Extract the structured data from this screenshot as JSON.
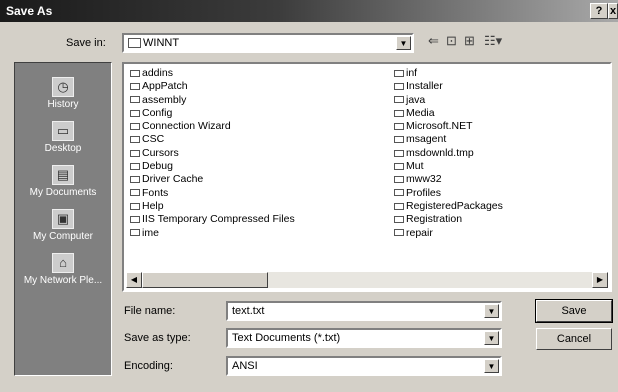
{
  "window": {
    "title": "Save As",
    "help_label": "?",
    "close_label": "x"
  },
  "toolbar": {
    "save_in_label": "Save in:",
    "save_in_value": "WINNT",
    "back_icon": "back-arrow-icon",
    "up_icon": "up-folder-icon",
    "new_folder_icon": "new-folder-icon",
    "views_icon": "views-menu-icon"
  },
  "places": [
    {
      "label": "History",
      "icon": "history-icon"
    },
    {
      "label": "Desktop",
      "icon": "desktop-icon"
    },
    {
      "label": "My Documents",
      "icon": "my-documents-icon"
    },
    {
      "label": "My Computer",
      "icon": "my-computer-icon"
    },
    {
      "label": "My Network Ple...",
      "icon": "network-places-icon"
    }
  ],
  "files_col1": [
    "addins",
    "AppPatch",
    "assembly",
    "Config",
    "Connection Wizard",
    "CSC",
    "Cursors",
    "Debug",
    "Driver Cache",
    "Fonts",
    "Help",
    "IIS Temporary Compressed Files",
    "ime"
  ],
  "files_col2": [
    "inf",
    "Installer",
    "java",
    "Media",
    "Microsoft.NET",
    "msagent",
    "msdownld.tmp",
    "Mut",
    "mww32",
    "Profiles",
    "RegisteredPackages",
    "Registration",
    "repair"
  ],
  "form": {
    "file_name_label": "File name:",
    "file_name_value": "text.txt",
    "save_as_type_label": "Save as type:",
    "save_as_type_value": "Text Documents (*.txt)",
    "encoding_label": "Encoding:",
    "encoding_value": "ANSI"
  },
  "buttons": {
    "save": "Save",
    "cancel": "Cancel"
  }
}
